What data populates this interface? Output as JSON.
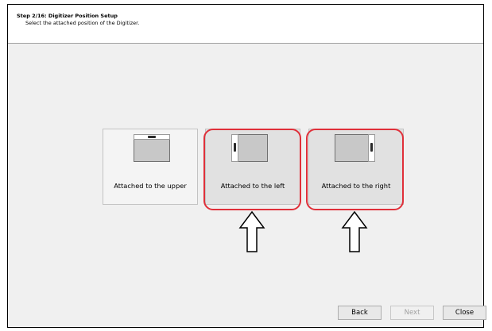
{
  "header": {
    "title": "Step 2/16: Digitizer Position Setup",
    "subtitle": "Select the attached position of the Digitizer."
  },
  "options": [
    {
      "label": "Attached to the upper",
      "position": "upper"
    },
    {
      "label": "Attached to the left",
      "position": "left"
    },
    {
      "label": "Attached to the right",
      "position": "right"
    }
  ],
  "footer": {
    "back_label": "Back",
    "next_label": "Next",
    "close_label": "Close"
  },
  "colors": {
    "highlight": "#e0303a",
    "background": "#f0f0f0"
  }
}
